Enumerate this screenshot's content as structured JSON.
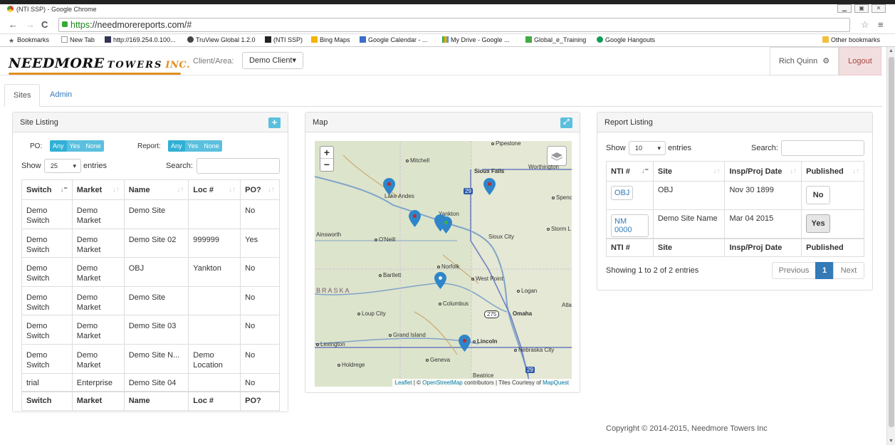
{
  "browser": {
    "tab_title": "(NTI SSP) - Google Chrome",
    "url_https": "https",
    "url_rest": "://needmorereports.com/#",
    "bookmarks": [
      {
        "label": "Bookmarks",
        "icon": "star-icon"
      },
      {
        "label": "New Tab",
        "icon": "page-icon"
      },
      {
        "label": "http://169.254.0.100...",
        "icon": "router-icon"
      },
      {
        "label": "TruView Global 1.2.0",
        "icon": "globe-icon"
      },
      {
        "label": "(NTI SSP)",
        "icon": "nti-icon"
      },
      {
        "label": "Bing Maps",
        "icon": "bing-icon"
      },
      {
        "label": "Google Calendar - ...",
        "icon": "calendar-icon"
      },
      {
        "label": "My Drive - Google ...",
        "icon": "drive-icon"
      },
      {
        "label": "Global_e_Training",
        "icon": "training-icon"
      },
      {
        "label": "Google Hangouts",
        "icon": "hangouts-icon"
      }
    ],
    "other_bookmarks": "Other bookmarks"
  },
  "header": {
    "logo_main": "NEEDMORE",
    "logo_towers": "TOWERS",
    "logo_inc": "INC.",
    "client_label": "Client/Area:",
    "client_value": "Demo Client",
    "user_name": "Rich Quinn",
    "logout": "Logout"
  },
  "tabs": [
    "Sites",
    "Admin"
  ],
  "site_listing": {
    "title": "Site Listing",
    "po_label": "PO:",
    "report_label": "Report:",
    "filter_options": [
      "Any",
      "Yes",
      "None"
    ],
    "show_label": "Show",
    "show_value": "25",
    "entries_label": "entries",
    "search_label": "Search:",
    "columns": [
      "Switch",
      "Market",
      "Name",
      "Loc #",
      "PO?"
    ],
    "rows": [
      [
        "Demo Switch",
        "Demo Market",
        "Demo Site",
        "",
        "No"
      ],
      [
        "Demo Switch",
        "Demo Market",
        "Demo Site 02",
        "999999",
        "Yes"
      ],
      [
        "Demo Switch",
        "Demo Market",
        "OBJ",
        "Yankton",
        "No"
      ],
      [
        "Demo Switch",
        "Demo Market",
        "Demo Site",
        "",
        "No"
      ],
      [
        "Demo Switch",
        "Demo Market",
        "Demo Site 03",
        "",
        "No"
      ],
      [
        "Demo Switch",
        "Demo Market",
        "Demo Site N...",
        "Demo Location",
        "No"
      ],
      [
        "trial",
        "Enterprise",
        "Demo Site 04",
        "",
        "No"
      ]
    ]
  },
  "map": {
    "title": "Map",
    "zoom_in": "+",
    "zoom_out": "−",
    "labels": [
      "Pipestone",
      "Mitchell",
      "Sioux Falls",
      "Worthington",
      "Spence",
      "Lake Andes",
      "Yankton",
      "Ainsworth",
      "O'Neill",
      "Sioux City",
      "Storm L",
      "Norfolk",
      "Bartlett",
      "West Point",
      "BRASKA",
      "Logan",
      "Columbus",
      "Loup City",
      "Omaha",
      "Atla",
      "Grand Island",
      "Lexington",
      "Lincoln",
      "Nebraska City",
      "Geneva",
      "Holdrege",
      "Beatrice",
      "29",
      "275"
    ],
    "attribution_leaflet": "Leaflet",
    "attribution_sep": " | © ",
    "attribution_osm": "OpenStreetMap",
    "attribution_mid": " contributors | Tiles Courtesy of ",
    "attribution_mq": "MapQuest"
  },
  "report_listing": {
    "title": "Report Listing",
    "show_label": "Show",
    "show_value": "10",
    "entries_label": "entries",
    "search_label": "Search:",
    "columns": [
      "NTI #",
      "Site",
      "Insp/Proj Date",
      "Published"
    ],
    "rows": [
      {
        "nti": "OBJ",
        "site": "OBJ",
        "date": "Nov 30 1899",
        "published": "No"
      },
      {
        "nti": "NM 0000",
        "site": "Demo Site Name",
        "date": "Mar 04 2015",
        "published": "Yes"
      }
    ],
    "info": "Showing 1 to 2 of 2 entries",
    "prev": "Previous",
    "page": "1",
    "next": "Next"
  },
  "footer": "Copyright © 2014-2015, Needmore Towers Inc",
  "colors": {
    "accent": "#5bc0de",
    "link": "#337ab7",
    "logo_orange": "#e09020",
    "logout_bg": "#f2dede"
  }
}
